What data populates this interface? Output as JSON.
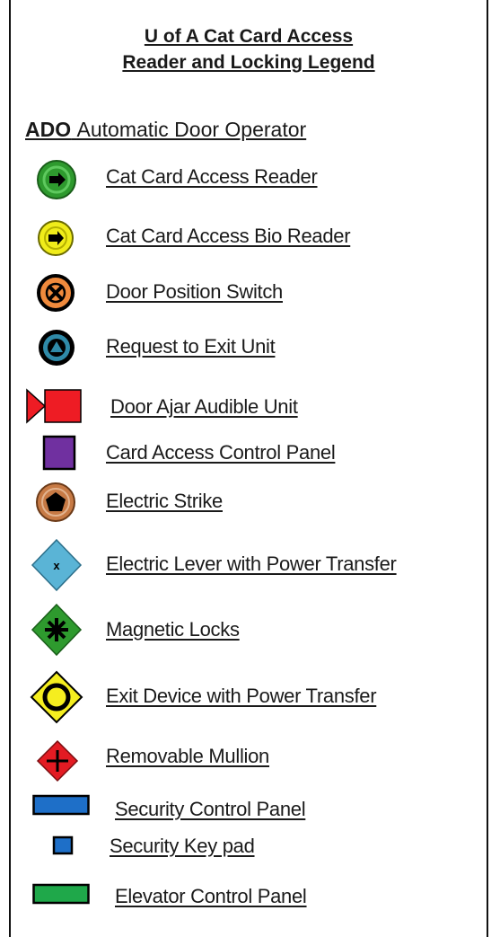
{
  "legend": {
    "title_line1": "U of A Cat Card Access",
    "title_line2": "Reader and Locking Legend",
    "ado_abbr": "ADO",
    "ado_text": "Automatic Door Operator"
  },
  "items": [
    {
      "label": "Cat Card Access Reader",
      "icon": "green-arrow-circle-icon",
      "color": "#2e9a2e"
    },
    {
      "label": "Cat Card Access Bio Reader",
      "icon": "yellow-arrow-circle-icon",
      "color": "#f0ec1a"
    },
    {
      "label": "Door Position Switch",
      "icon": "orange-x-circle-icon",
      "color": "#f08a3c"
    },
    {
      "label": "Request to Exit Unit",
      "icon": "teal-triangle-circle-icon",
      "color": "#2f8aa8"
    },
    {
      "label": "Door Ajar Audible Unit",
      "icon": "red-flag-square-icon",
      "color": "#ee1c24"
    },
    {
      "label": "Card Access Control Panel",
      "icon": "purple-square-icon",
      "color": "#7030a0"
    },
    {
      "label": "Electric Strike",
      "icon": "brown-pentagon-circle-icon",
      "color": "#c77a45"
    },
    {
      "label": "Electric Lever with Power Transfer",
      "icon": "blue-x-diamond-icon",
      "color": "#5ab4d6"
    },
    {
      "label": "Magnetic Locks",
      "icon": "green-star-diamond-icon",
      "color": "#2e9a2e"
    },
    {
      "label": "Exit Device with Power Transfer",
      "icon": "yellow-circle-diamond-icon",
      "color": "#f5ee1f"
    },
    {
      "label": "Removable Mullion",
      "icon": "red-cross-diamond-icon",
      "color": "#e31b23"
    },
    {
      "label": "Security Control Panel",
      "icon": "blue-rectangle-icon",
      "color": "#1e6fc8"
    },
    {
      "label": "Security Key pad",
      "icon": "blue-small-square-icon",
      "color": "#1e6fc8"
    },
    {
      "label": "Elevator Control Panel",
      "icon": "green-rectangle-icon",
      "color": "#1fa84a"
    }
  ]
}
